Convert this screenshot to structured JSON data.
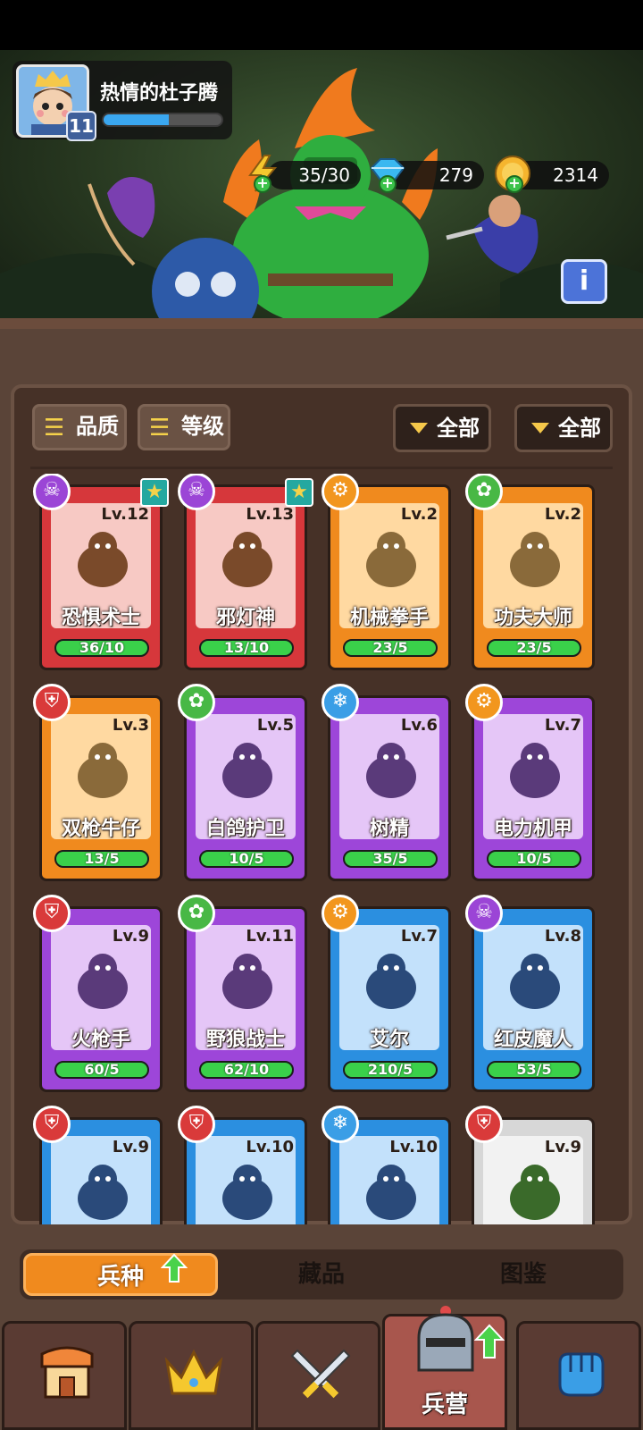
{
  "player": {
    "name": "热情的杜子腾",
    "level": "11",
    "xp_fraction": 0.55
  },
  "resources": {
    "energy": {
      "value": "35/30",
      "icon": "lightning-icon"
    },
    "gems": {
      "value": "279",
      "icon": "diamond-icon"
    },
    "coins": {
      "value": "2314",
      "icon": "coin-icon"
    }
  },
  "filters": {
    "quality_label": "品质",
    "level_label": "等级",
    "dropdown1": "全部",
    "dropdown2": "全部"
  },
  "cards": [
    {
      "name": "恐惧术士",
      "level": "Lv.12",
      "count": "36/10",
      "rarity": "red",
      "class": "skull",
      "starred": true
    },
    {
      "name": "邪灯神",
      "level": "Lv.13",
      "count": "13/10",
      "rarity": "red",
      "class": "skull",
      "starred": true
    },
    {
      "name": "机械拳手",
      "level": "Lv.2",
      "count": "23/5",
      "rarity": "orange",
      "class": "gear",
      "starred": false
    },
    {
      "name": "功夫大师",
      "level": "Lv.2",
      "count": "23/5",
      "rarity": "orange",
      "class": "paw",
      "starred": false
    },
    {
      "name": "双枪牛仔",
      "level": "Lv.3",
      "count": "13/5",
      "rarity": "orange",
      "class": "helmet",
      "starred": false
    },
    {
      "name": "白鸽护卫",
      "level": "Lv.5",
      "count": "10/5",
      "rarity": "purple",
      "class": "paw",
      "starred": false
    },
    {
      "name": "树精",
      "level": "Lv.6",
      "count": "35/5",
      "rarity": "purple",
      "class": "snow",
      "starred": false
    },
    {
      "name": "电力机甲",
      "level": "Lv.7",
      "count": "10/5",
      "rarity": "purple",
      "class": "gear",
      "starred": false
    },
    {
      "name": "火枪手",
      "level": "Lv.9",
      "count": "60/5",
      "rarity": "purple",
      "class": "helmet",
      "starred": false
    },
    {
      "name": "野狼战士",
      "level": "Lv.11",
      "count": "62/10",
      "rarity": "purple",
      "class": "paw",
      "starred": false
    },
    {
      "name": "艾尔",
      "level": "Lv.7",
      "count": "210/5",
      "rarity": "blue",
      "class": "gear",
      "starred": false
    },
    {
      "name": "红皮魔人",
      "level": "Lv.8",
      "count": "53/5",
      "rarity": "blue",
      "class": "skull",
      "starred": false
    },
    {
      "name": "",
      "level": "Lv.9",
      "count": "",
      "rarity": "blue",
      "class": "helmet",
      "starred": false
    },
    {
      "name": "",
      "level": "Lv.10",
      "count": "",
      "rarity": "blue",
      "class": "helmet",
      "starred": false
    },
    {
      "name": "",
      "level": "Lv.10",
      "count": "",
      "rarity": "blue",
      "class": "snow",
      "starred": false
    },
    {
      "name": "",
      "level": "Lv.9",
      "count": "",
      "rarity": "white",
      "class": "helmet",
      "starred": false
    }
  ],
  "subtabs": {
    "troops": "兵种",
    "collection": "藏品",
    "codex": "图鉴"
  },
  "nav": {
    "shop_icon": "shop-icon",
    "crown_icon": "crown-icon",
    "battle_icon": "crossed-swords-icon",
    "barracks_label": "兵营",
    "fist_icon": "fist-icon"
  }
}
